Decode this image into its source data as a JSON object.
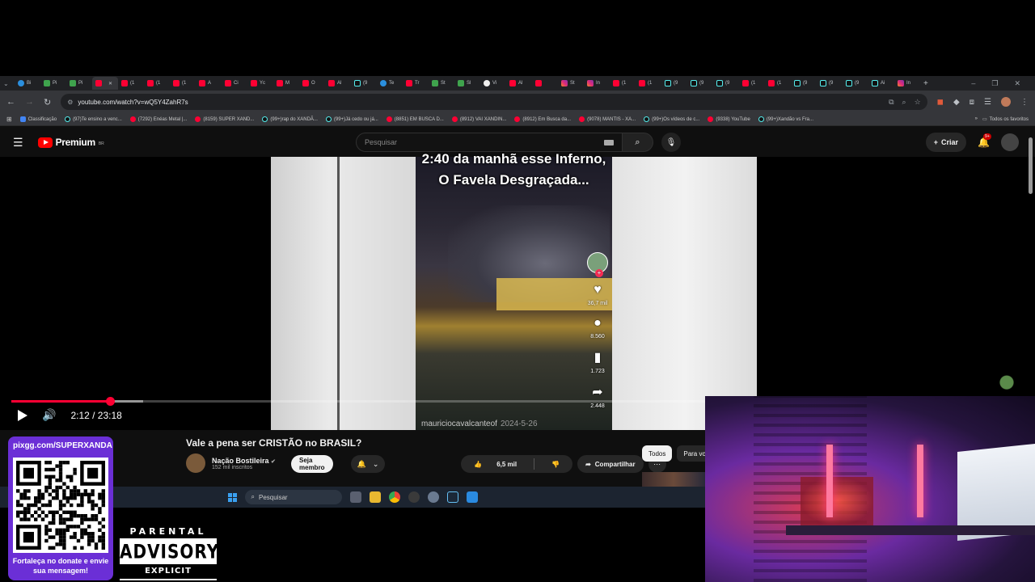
{
  "browser": {
    "tabs": [
      {
        "label": "Bi",
        "fav": "bl"
      },
      {
        "label": "Pi",
        "fav": "gr"
      },
      {
        "label": "Pi",
        "fav": "gr"
      },
      {
        "label": "",
        "fav": "yt",
        "active": true,
        "close": "✕"
      },
      {
        "label": "(1",
        "fav": "yt"
      },
      {
        "label": "(1",
        "fav": "yt"
      },
      {
        "label": "(1",
        "fav": "yt"
      },
      {
        "label": "A",
        "fav": "yt"
      },
      {
        "label": "Ci",
        "fav": "yt"
      },
      {
        "label": "Yc",
        "fav": "yt"
      },
      {
        "label": "M",
        "fav": "yt"
      },
      {
        "label": "O",
        "fav": "yt"
      },
      {
        "label": "Al",
        "fav": "yt"
      },
      {
        "label": "(9",
        "fav": "tt"
      },
      {
        "label": "Te",
        "fav": "bl"
      },
      {
        "label": "Tr",
        "fav": "yt"
      },
      {
        "label": "St",
        "fav": "gr"
      },
      {
        "label": "Sl",
        "fav": "gr"
      },
      {
        "label": "Vi",
        "fav": "wh"
      },
      {
        "label": "Al",
        "fav": "yt"
      },
      {
        "label": "",
        "fav": "yt"
      },
      {
        "label": "St",
        "fav": "ig"
      },
      {
        "label": "In",
        "fav": "ig"
      },
      {
        "label": "(1",
        "fav": "yt"
      },
      {
        "label": "(1",
        "fav": "yt"
      },
      {
        "label": "(9",
        "fav": "tt"
      },
      {
        "label": "(9",
        "fav": "tt"
      },
      {
        "label": "(9",
        "fav": "tt"
      },
      {
        "label": "(1",
        "fav": "yt"
      },
      {
        "label": "(1",
        "fav": "yt"
      },
      {
        "label": "(9",
        "fav": "tt"
      },
      {
        "label": "(9",
        "fav": "tt"
      },
      {
        "label": "(9",
        "fav": "tt"
      },
      {
        "label": "Ai",
        "fav": "tt"
      },
      {
        "label": "In",
        "fav": "ig"
      }
    ],
    "new_tab": "+",
    "window_controls": [
      "–",
      "❐",
      "✕"
    ],
    "url": "youtube.com/watch?v=wQ5Y4ZahR7s",
    "bookmarks": [
      {
        "label": "Classificação",
        "fav": "cl"
      },
      {
        "label": "(97)Te ensino a venc...",
        "fav": "tt"
      },
      {
        "label": "(7292) Enéas Metal |...",
        "fav": "yt"
      },
      {
        "label": "(8159) SUPER XAND...",
        "fav": "yt"
      },
      {
        "label": "(99+)rap do XANDÃ...",
        "fav": "tt"
      },
      {
        "label": "(99+)Já cedo ou já...",
        "fav": "tt"
      },
      {
        "label": "(8851) EM BUSCA D...",
        "fav": "yt"
      },
      {
        "label": "(8912) VAI XANDIN...",
        "fav": "yt"
      },
      {
        "label": "(8912) Em Busca da...",
        "fav": "yt"
      },
      {
        "label": "(9078) MANTIS - XA...",
        "fav": "yt"
      },
      {
        "label": "(99+)Os vídeos de c...",
        "fav": "tt"
      },
      {
        "label": "(9338) YouTube",
        "fav": "yt"
      },
      {
        "label": "(99+)Xandão vs Fra...",
        "fav": "tt"
      }
    ],
    "bookmarks_more": "»",
    "all_bookmarks": "Todos os favoritos"
  },
  "youtube": {
    "logo_text": "Premium",
    "logo_country": "BR",
    "search_placeholder": "Pesquisar",
    "create_label": "Criar",
    "notif_badge": "9+",
    "video": {
      "overlay_text": "2:40 da manhã esse Inferno, O Favela Desgraçada...",
      "likes": "36,7 mil",
      "comments": "8.560",
      "saves": "1.723",
      "shares": "2.448",
      "author": "mauriciocavalcanteof",
      "date": "2024-5-26"
    },
    "player": {
      "time": "2:12 / 23:18",
      "played_fraction": 0.1417,
      "loaded_fraction": 0.19
    },
    "title": "Vale a pena ser CRISTÃO no BRASIL?",
    "channel_name": "Nação Bostileira",
    "subscribers": "152 mil inscritos",
    "member_label": "Seja membro",
    "like_count": "6,5 mil",
    "share_label": "Compartilhar",
    "chips": [
      "Todos",
      "Para vc"
    ]
  },
  "taskbar": {
    "search_placeholder": "Pesquisar"
  },
  "overlays": {
    "pix_url": "pixgg.com/SUPERXANDA",
    "pix_message": "Fortaleça no donate e envie sua mensagem!",
    "advisory_top": "PARENTAL",
    "advisory_main": "ADVISORY",
    "advisory_bottom": "EXPLICIT CONTENT"
  }
}
